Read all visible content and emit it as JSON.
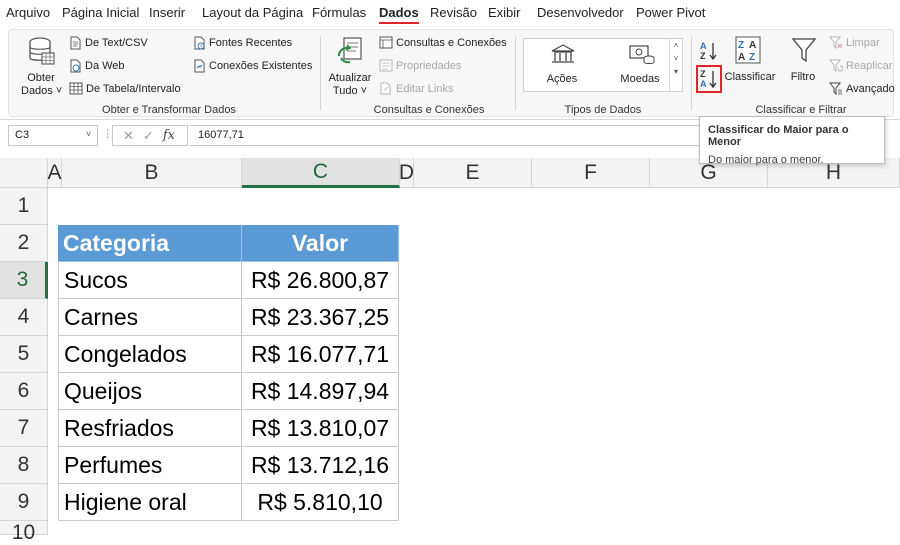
{
  "menu": [
    "Arquivo",
    "Página Inicial",
    "Inserir",
    "Layout da Página",
    "Fórmulas",
    "Dados",
    "Revisão",
    "Exibir",
    "Desenvolvedor",
    "Power Pivot"
  ],
  "active_tab": "Dados",
  "ribbon": {
    "obter": {
      "big_label_1": "Obter",
      "big_label_2": "Dados ˅",
      "items": [
        "De Text/CSV",
        "Da Web",
        "De Tabela/Intervalo",
        "Fontes Recentes",
        "Conexões Existentes"
      ],
      "group_label": "Obter e Transformar Dados"
    },
    "consultas": {
      "big_label_1": "Atualizar",
      "big_label_2": "Tudo ˅",
      "items": [
        "Consultas e Conexões",
        "Propriedades",
        "Editar Links"
      ],
      "group_label": "Consultas e Conexões"
    },
    "tipos": {
      "items": [
        "Ações",
        "Moedas"
      ],
      "group_label": "Tipos de Dados"
    },
    "classificar": {
      "sort_label": "Classificar",
      "filter_label": "Filtro",
      "small_items": [
        "Limpar",
        "Reaplicar",
        "Avançado"
      ],
      "group_label": "Classificar e Filtrar"
    }
  },
  "tooltip": {
    "title": "Classificar do Maior para o Menor",
    "description": "Do maior para o menor."
  },
  "formula_bar": {
    "name_box": "C3",
    "fx": "fx",
    "value": "16077,71"
  },
  "columns": [
    "A",
    "B",
    "C",
    "D",
    "E",
    "F",
    "G",
    "H"
  ],
  "selected_column": "C",
  "rows": [
    "1",
    "2",
    "3",
    "4",
    "5",
    "6",
    "7",
    "8",
    "9",
    "10"
  ],
  "selected_row": "3",
  "table": {
    "headers": [
      "Categoria",
      "Valor"
    ],
    "rows": [
      [
        "Sucos",
        "R$ 26.800,87"
      ],
      [
        "Carnes",
        "R$ 23.367,25"
      ],
      [
        "Congelados",
        "R$ 16.077,71"
      ],
      [
        "Queijos",
        "R$ 14.897,94"
      ],
      [
        "Resfriados",
        "R$ 13.810,07"
      ],
      [
        "Perfumes",
        "R$ 13.712,16"
      ],
      [
        "Higiene oral",
        "R$ 5.810,10"
      ]
    ]
  },
  "colors": {
    "table_header": "#5b9bd5",
    "highlight": "#e0252a",
    "excel_green": "#217346"
  }
}
